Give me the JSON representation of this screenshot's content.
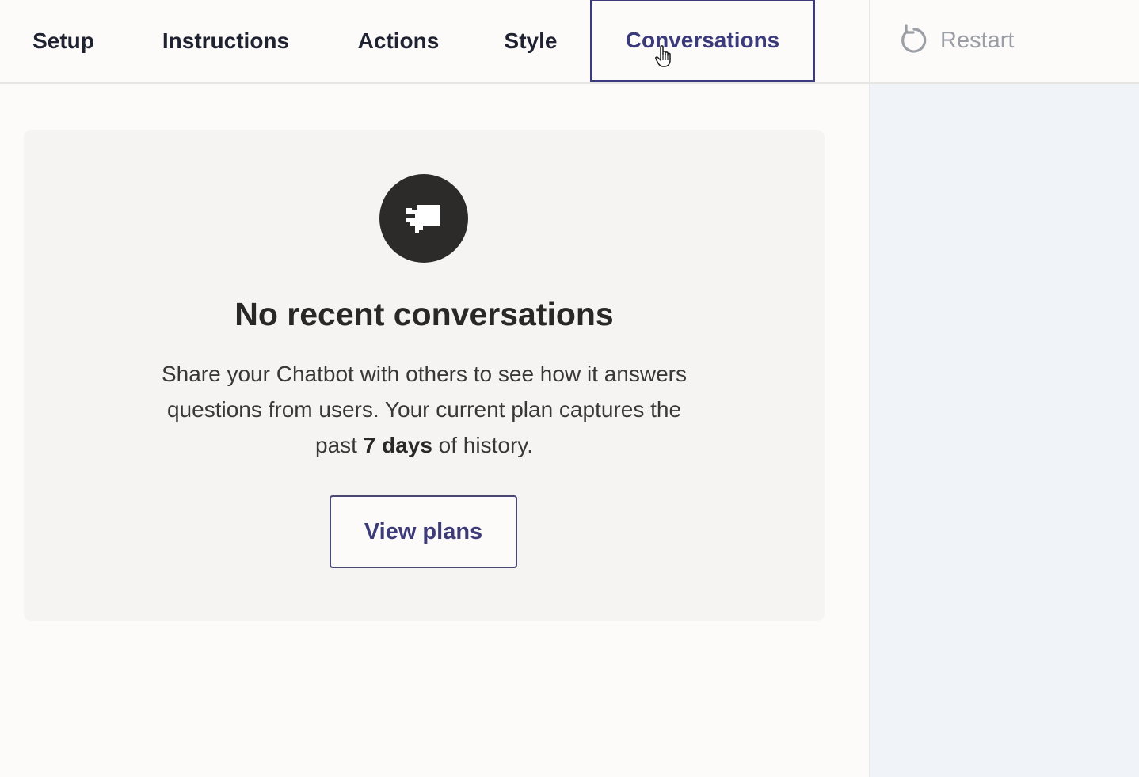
{
  "tabs": [
    {
      "label": "Setup",
      "active": false
    },
    {
      "label": "Instructions",
      "active": false
    },
    {
      "label": "Actions",
      "active": false
    },
    {
      "label": "Style",
      "active": false
    },
    {
      "label": "Conversations",
      "active": true
    }
  ],
  "restart": {
    "label": "Restart",
    "icon": "restart-icon",
    "color": "#9c9ea6"
  },
  "empty_state": {
    "icon": "chat-bubble-icon",
    "title": "No recent conversations",
    "desc_part1": "Share your Chatbot with others to see how it answers questions from users. Your current plan captures the past ",
    "desc_bold": "7 days",
    "desc_part2": " of history.",
    "button_label": "View plans"
  },
  "colors": {
    "accent": "#3b3a7a",
    "badge": "#2d2b29",
    "card": "#f5f4f2",
    "preview_panel": "#f0f3f8"
  }
}
